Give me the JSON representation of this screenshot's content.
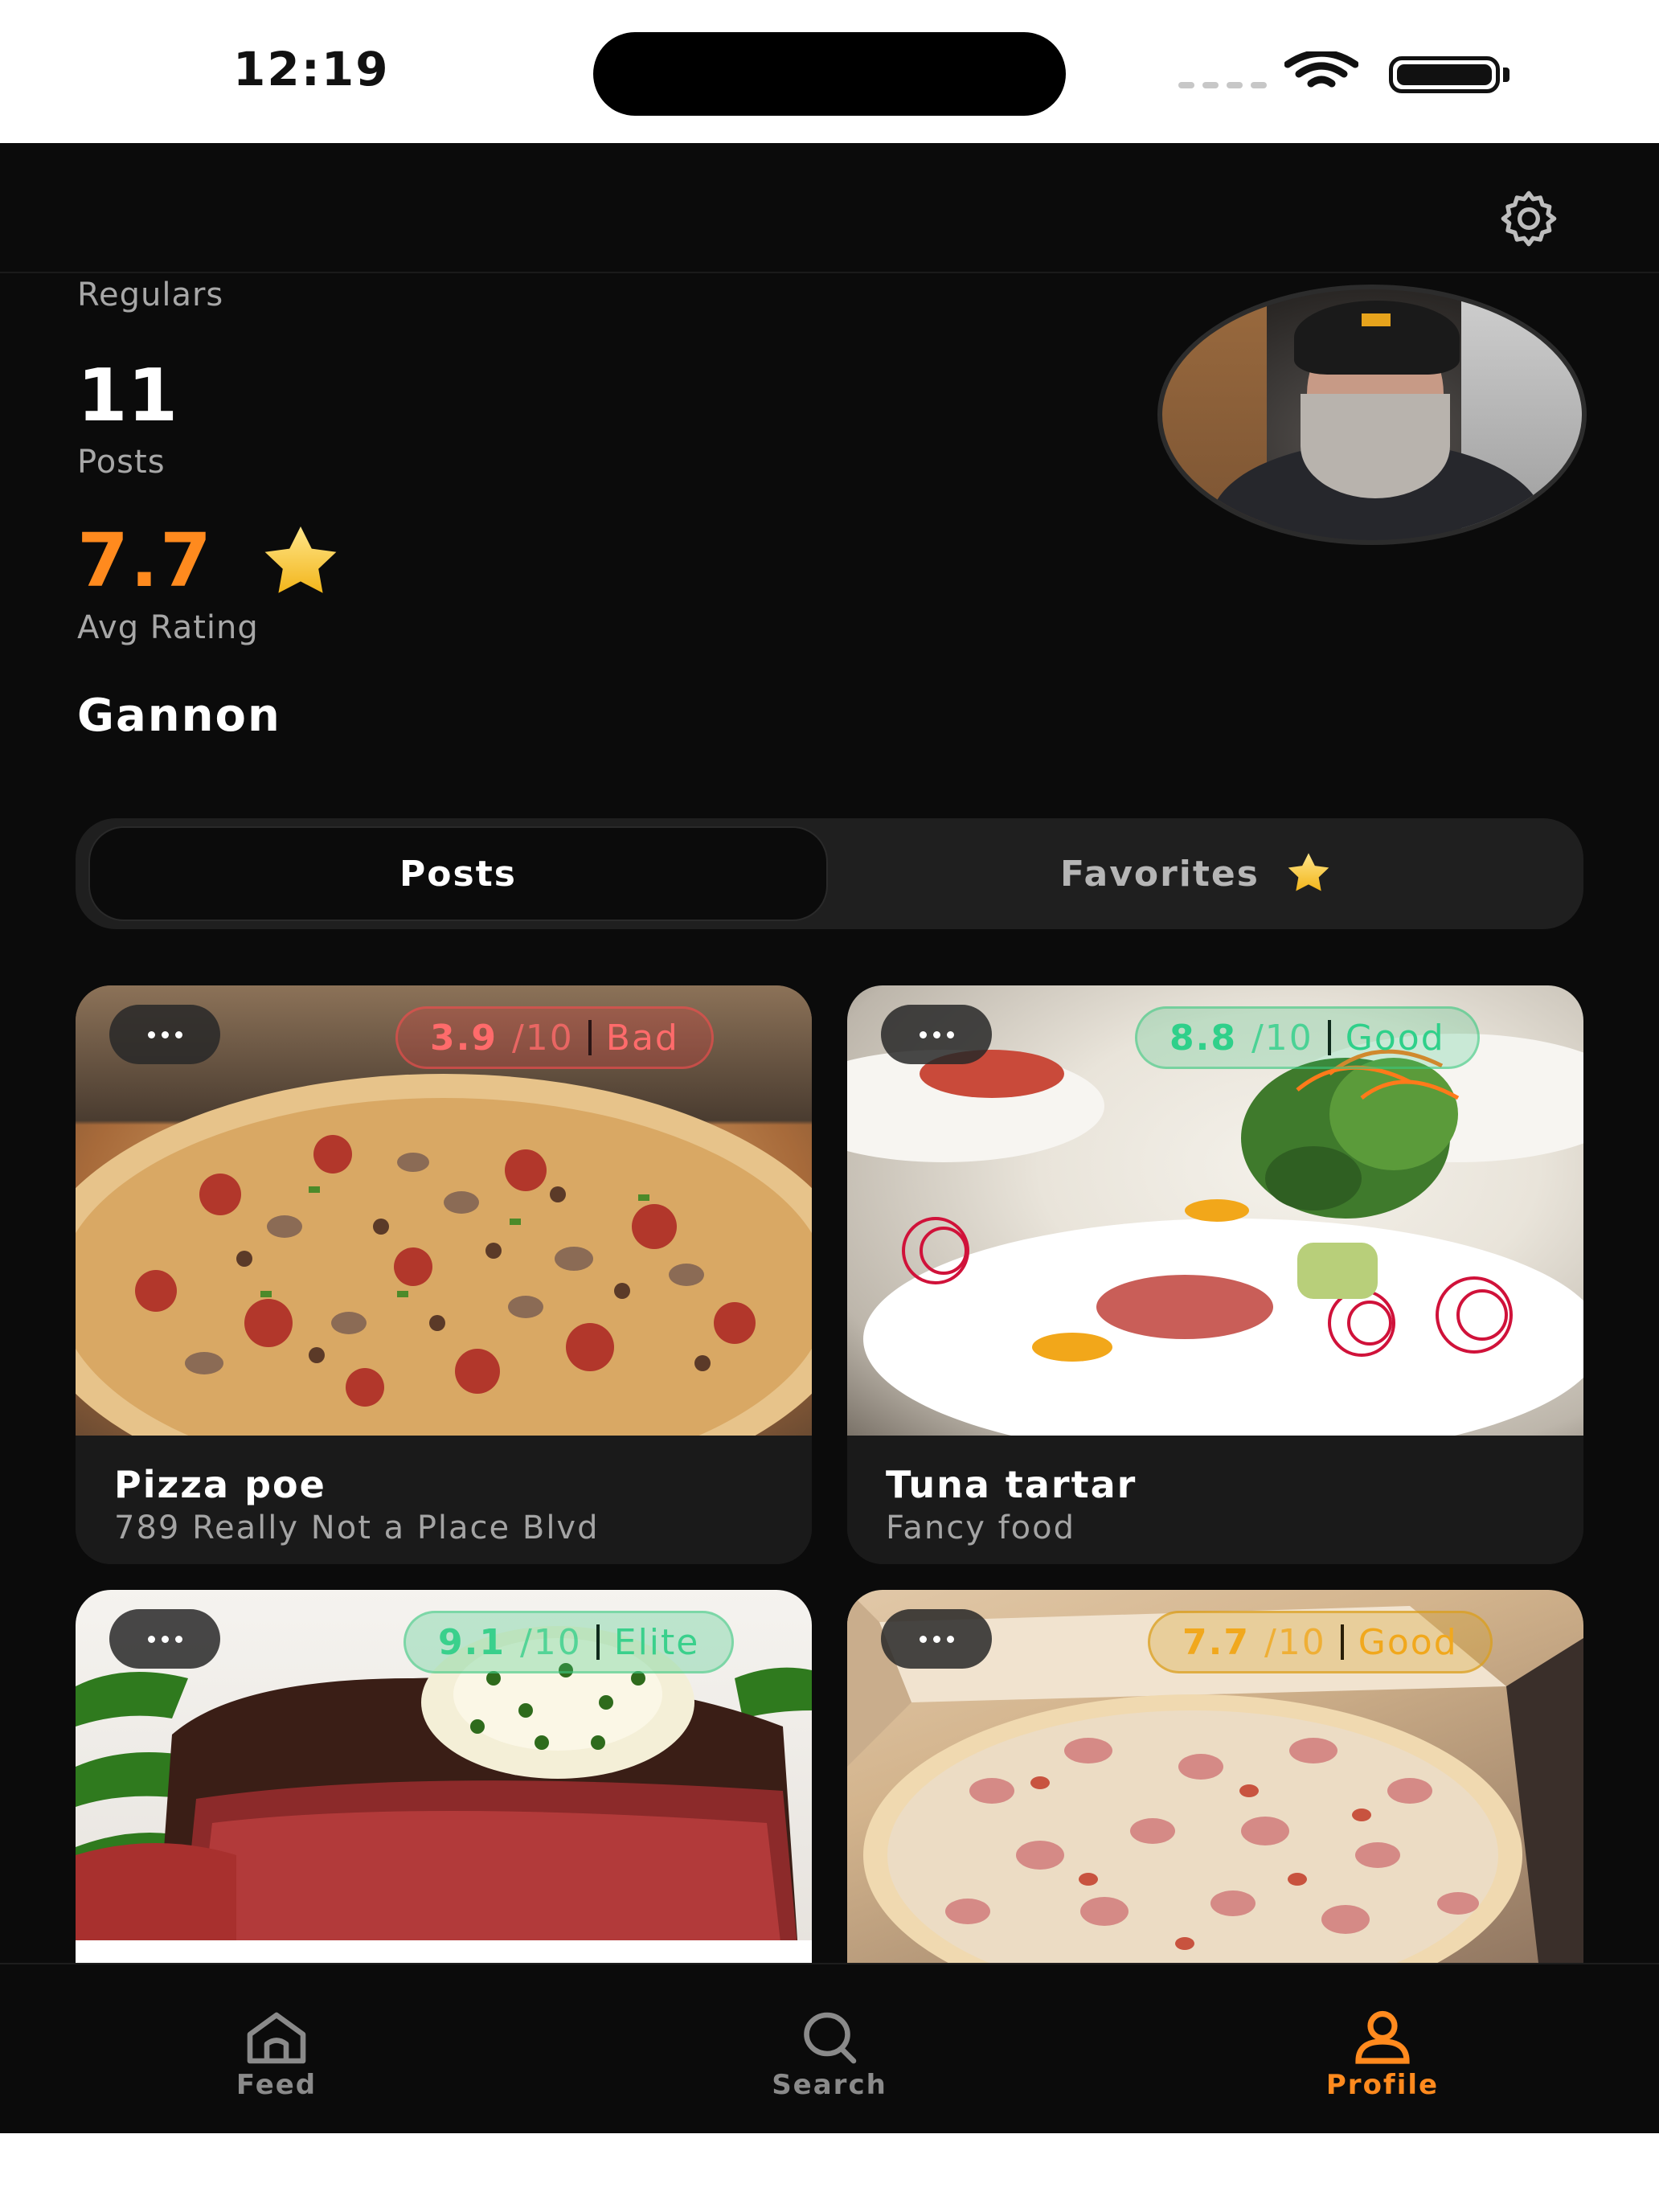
{
  "status_bar": {
    "time": "12:19"
  },
  "profile": {
    "regulars_label": "Regulars",
    "posts_count": "11",
    "posts_label": "Posts",
    "avg_rating": "7.7",
    "avg_rating_label": "Avg Rating",
    "username": "Gannon"
  },
  "tabs": {
    "posts": "Posts",
    "favorites": "Favorites"
  },
  "posts": [
    {
      "title": "Pizza poe",
      "subtitle": "789 Really Not a Place Blvd",
      "score": "3.9",
      "scale": "/10",
      "tier": "Bad",
      "tier_color": "#ff6b6b"
    },
    {
      "title": "Tuna tartar",
      "subtitle": "Fancy food",
      "score": "8.8",
      "scale": "/10",
      "tier": "Good",
      "tier_color": "#2fd08a"
    },
    {
      "title": "",
      "subtitle": "",
      "score": "9.1",
      "scale": "/10",
      "tier": "Elite",
      "tier_color": "#3ad08c"
    },
    {
      "title": "",
      "subtitle": "",
      "score": "7.7",
      "scale": "/10",
      "tier": "Good",
      "tier_color": "#f1a81d"
    }
  ],
  "nav": {
    "feed": "Feed",
    "search": "Search",
    "profile": "Profile"
  },
  "icons": {
    "settings": "gear-icon",
    "star": "star-icon",
    "more": "more-dots-icon",
    "feed": "home-icon",
    "search": "search-icon",
    "profile": "person-icon"
  },
  "colors": {
    "accent": "#ff8a1e",
    "background": "#0b0b0b",
    "card": "#1a1a1a"
  }
}
